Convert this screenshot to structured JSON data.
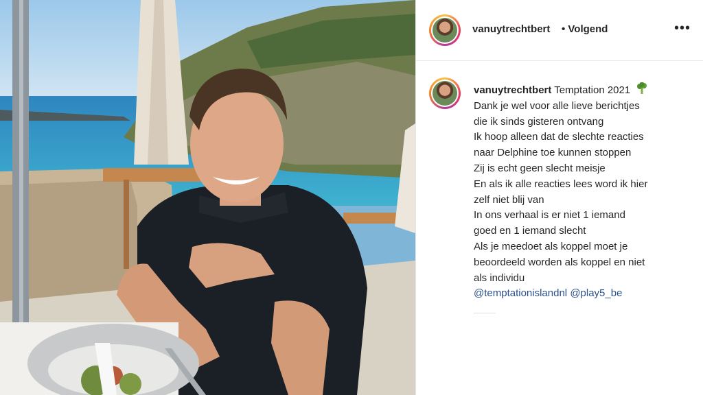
{
  "post": {
    "username": "vanuytrechtbert",
    "follow_label": "• Volgend",
    "more_label": "•••"
  },
  "caption": {
    "username": "vanuytrechtbert",
    "first_line": "Temptation 2021",
    "emoji_icon": "broccoli-icon",
    "lines": [
      "Dank je wel voor alle lieve berichtjes",
      "die ik sinds gisteren ontvang",
      "Ik hoop alleen dat de slechte reacties",
      "naar Delphine toe kunnen stoppen",
      "Zij is echt geen slecht meisje",
      "En als ik alle reacties lees word ik hier",
      "zelf niet blij van",
      "In ons verhaal is er niet 1 iemand",
      "goed en 1 iemand slecht",
      "Als je meedoet als koppel moet je",
      "beoordeeld worden als koppel en niet",
      "als individu"
    ],
    "mention_1": "@temptationislandnl",
    "mention_2": "@play5_be"
  },
  "colors": {
    "link": "#2a4f8a",
    "text": "#262626",
    "story_ring": "#ee3a5a"
  }
}
